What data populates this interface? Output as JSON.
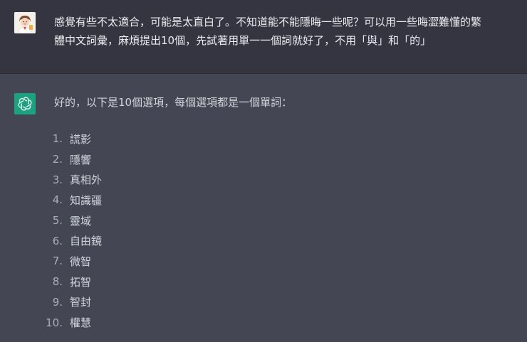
{
  "user_message": {
    "line1": "感覺有些不太適合，可能是太直白了。不知道能不能隱晦一些呢？可以用一些晦澀難懂的繁",
    "line2": "體中文詞彙，麻煩提出10個，先試著用單一一個詞就好了，不用「與」和「的」"
  },
  "assistant_message": {
    "intro": "好的，以下是10個選項，每個選項都是一個單詞：",
    "items": [
      {
        "num": "1.",
        "text": "謊影"
      },
      {
        "num": "2.",
        "text": "隱響"
      },
      {
        "num": "3.",
        "text": "真相外"
      },
      {
        "num": "4.",
        "text": "知識疆"
      },
      {
        "num": "5.",
        "text": "靈域"
      },
      {
        "num": "6.",
        "text": "自由鏡"
      },
      {
        "num": "7.",
        "text": "微智"
      },
      {
        "num": "8.",
        "text": "拓智"
      },
      {
        "num": "9.",
        "text": "智封"
      },
      {
        "num": "10.",
        "text": "權慧"
      }
    ]
  },
  "icons": {
    "user_avatar": "user-avatar-icon",
    "assistant_avatar": "openai-logo-icon"
  },
  "colors": {
    "user_bg": "#343541",
    "assistant_bg": "#444654",
    "brand_green": "#19a37f"
  }
}
